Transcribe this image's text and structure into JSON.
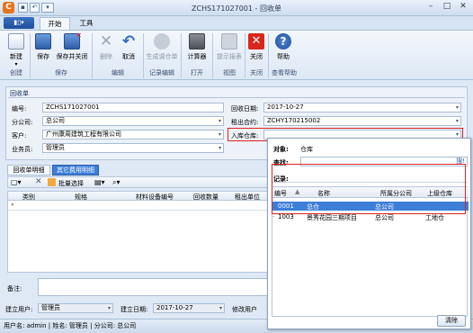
{
  "window": {
    "title": "ZCHS171027001 - 回收单",
    "app_icon": "C"
  },
  "ribbon": {
    "tabs": [
      "开始",
      "工具"
    ],
    "file_menu": "▮▯▾",
    "buttons": [
      {
        "label": "新建",
        "icon": "new-doc-icon",
        "sub": "▾"
      },
      {
        "label": "保存",
        "icon": "save-icon"
      },
      {
        "label": "保存并关闭",
        "icon": "save-close-icon"
      },
      {
        "label": "删除",
        "icon": "delete-icon",
        "disabled": true
      },
      {
        "label": "取消",
        "icon": "undo-icon"
      },
      {
        "label": "生成调仓单",
        "icon": "transfer-icon",
        "disabled": true
      },
      {
        "label": "计算器",
        "icon": "calculator-icon"
      },
      {
        "label": "提示报表",
        "icon": "report-icon",
        "disabled": true
      },
      {
        "label": "关闭",
        "icon": "close-icon"
      },
      {
        "label": "帮助",
        "icon": "help-icon"
      }
    ],
    "groups": [
      "创建",
      "保存",
      "编辑",
      "记录编辑",
      "打开",
      "视图",
      "关闭",
      "查看帮助"
    ]
  },
  "form": {
    "section_title": "回收单",
    "number_label": "编号:",
    "number_value": "ZCHS171027001",
    "branch_label": "分公司:",
    "branch_value": "总公司",
    "customer_label": "客户:",
    "customer_value": "广州康周建筑工程有限公司",
    "salesman_label": "业务员:",
    "salesman_value": "管理员",
    "date_label": "回收日期:",
    "date_value": "2017-10-27",
    "contract_label": "租出合约:",
    "contract_value": "ZCHY170215002",
    "warehouse_label": "入库仓库:",
    "warehouse_value": ""
  },
  "detail": {
    "tabs": [
      "回收单明细",
      "其它费用明细"
    ],
    "toolbar": {
      "batch_select": "批量选择"
    },
    "columns": [
      "类别",
      "规格",
      "材料设备编号",
      "回收数量",
      "租出单位"
    ]
  },
  "bottom": {
    "remark_label": "备注:",
    "creator_label": "建立用户:",
    "creator_value": "管理员",
    "created_label": "建立日期:",
    "created_value": "2017-10-27",
    "modifier_label": "修改用户"
  },
  "status": {
    "text": "用户名: admin | 姓名: 管理员 | 分公司: 总公司"
  },
  "popup": {
    "object_label": "对象:",
    "object_value": "仓库",
    "search_label": "查找:",
    "search_placeholder": "",
    "search_button": "搜!",
    "records_label": "记录:",
    "columns": [
      "编号",
      "名称",
      "所属分公司",
      "上级仓库"
    ],
    "rows": [
      {
        "code": "0001",
        "name": "总仓",
        "branch": "总公司",
        "parent": ""
      },
      {
        "code": "1003",
        "name": "景秀花园三期项目",
        "branch": "总公司",
        "parent": "工地仓"
      }
    ],
    "clear_button": "清除"
  },
  "colors": {
    "highlight_red": "#e02020",
    "selected_row": "#3d7ed8",
    "accent": "#1f4f9c"
  }
}
